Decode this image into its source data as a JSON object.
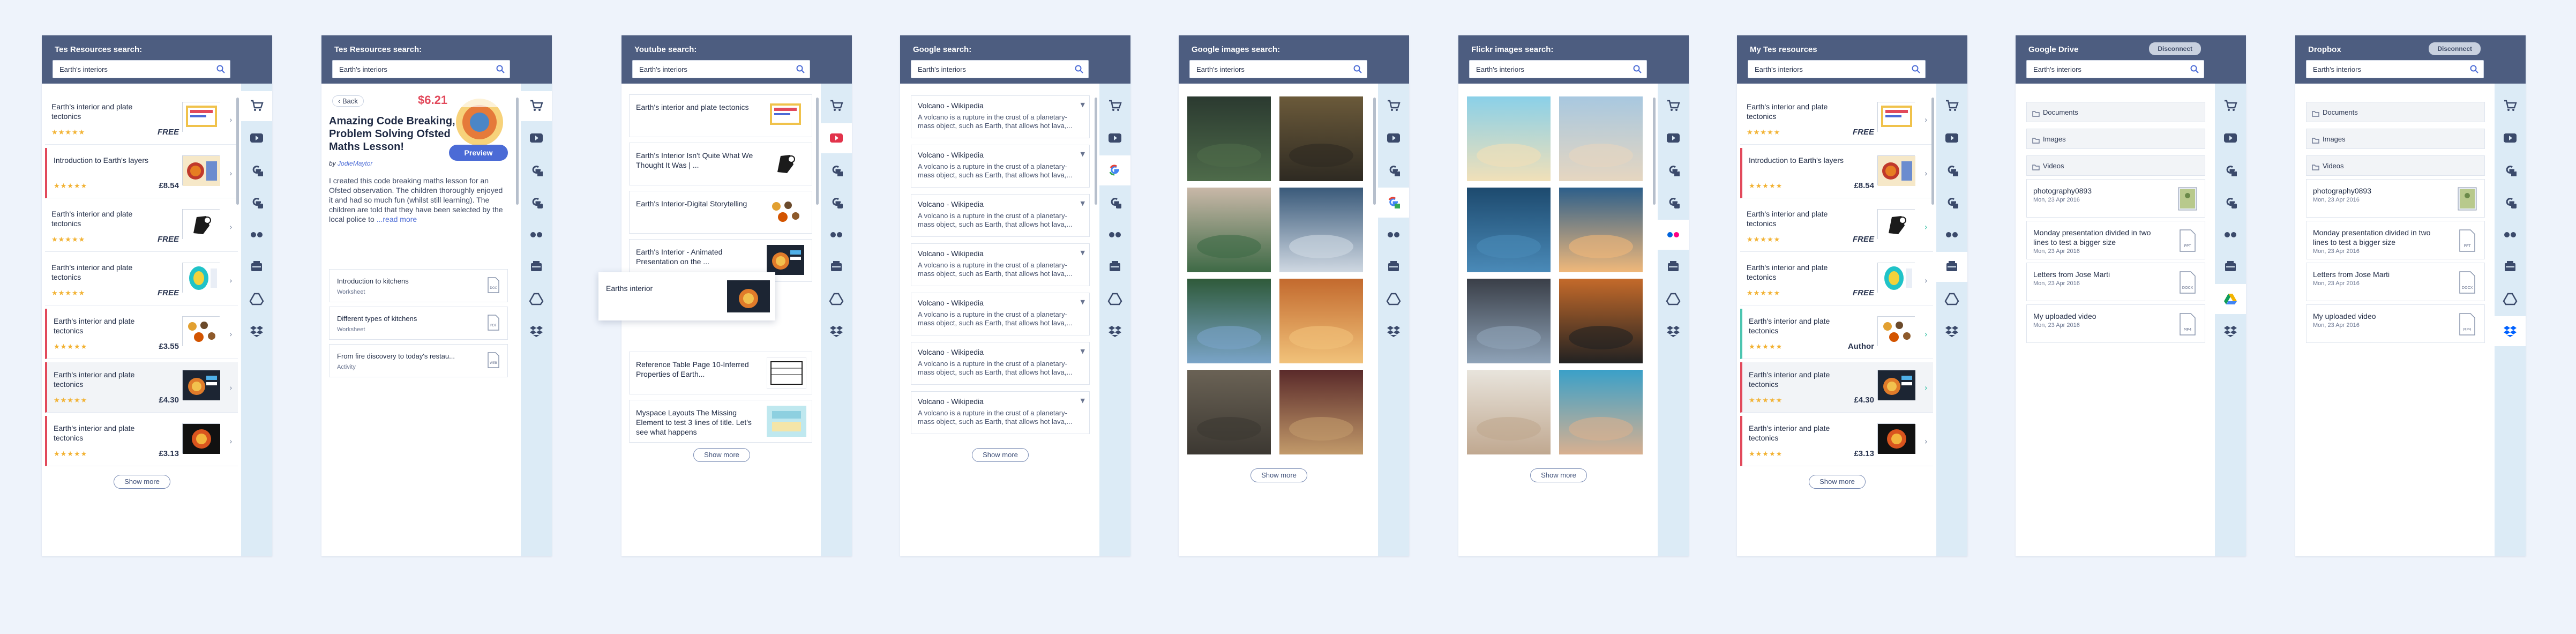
{
  "colors": {
    "header": "#4d5d80",
    "rail": "#dcebf6",
    "accent": "#4b6bd6",
    "price_red": "#e2495b",
    "star": "#f2b233",
    "teal": "#4cc5b0"
  },
  "search_query": "Earth's interiors",
  "show_more": "Show more",
  "rail_icons": [
    "cart-icon",
    "youtube-icon",
    "google-icon",
    "google-images-icon",
    "flickr-icon",
    "tes-box-icon",
    "drive-icon",
    "dropbox-icon"
  ],
  "panels": {
    "tes": {
      "title": "Tes Resources search:",
      "items": [
        {
          "title": "Earth's interior and plate tectonics",
          "price": "FREE",
          "stars": "★★★★★"
        },
        {
          "title": "Introduction to Earth's layers",
          "price": "£8.54",
          "stars": "★★★★★"
        },
        {
          "title": "Earth's interior and plate tectonics",
          "price": "FREE",
          "stars": "★★★★★"
        },
        {
          "title": "Earth's interior and plate tectonics",
          "price": "FREE",
          "stars": "★★★★★"
        },
        {
          "title": "Earth's interior and plate tectonics",
          "price": "£3.55",
          "stars": "★★★★★"
        },
        {
          "title": "Earth's interior and plate tectonics",
          "price": "£4.30",
          "stars": "★★★★★"
        },
        {
          "title": "Earth's interior and plate tectonics",
          "price": "£3.13",
          "stars": "★★★★★"
        }
      ]
    },
    "preview": {
      "title": "Tes Resources search:",
      "back": "‹ Back",
      "price": "$6.21",
      "heading": "Amazing Code Breaking, Problem Solving Ofsted Maths Lesson!",
      "by": "by",
      "author": "JodieMaytor",
      "preview_btn": "Preview",
      "description": "I created this code breaking maths lesson for an Ofsted observation. The children thoroughly enjoyed it and had so much fun (whilst still learning). The children are told that they have been selected by the local police to ",
      "read_more": "...read more",
      "resources": [
        {
          "name": "Introduction to kitchens",
          "type": "Worksheet",
          "icon": "DOC"
        },
        {
          "name": "Different types of kitchens",
          "type": "Worksheet",
          "icon": "PDF"
        },
        {
          "name": "From fire discovery to today's restau...",
          "type": "Activity",
          "icon": "WEB"
        }
      ]
    },
    "youtube": {
      "title": "Youtube search:",
      "items": [
        "Earth's interior and plate tectonics",
        "Earth's Interior Isn't Quite What We Thought It Was | ...",
        "Earth's Interior-Digital Storytelling",
        "Earth's Interior - Animated Presentation on the ...",
        "Reference Table Page 10-Inferred Properties of Earth...",
        "Myspace Layouts The Missing Element to test 3 lines of title. Let's see what happens"
      ],
      "tooltip": "Earths interior"
    },
    "google": {
      "title": "Google search:",
      "result_title": "Volcano - Wikipedia",
      "result_text": "A volcano is a rupture in the crust of a planetary-mass object, such as Earth, that allows hot lava,...",
      "count": 7
    },
    "google_images": {
      "title": "Google images search:"
    },
    "flickr": {
      "title": "Flickr images search:"
    },
    "my_tes": {
      "title": "My Tes resources",
      "items": [
        {
          "title": "Earth's interior and plate tectonics",
          "price": "FREE",
          "stars": "★★★★★"
        },
        {
          "title": "Introduction to Earth's layers",
          "price": "£8.54",
          "stars": "★★★★★"
        },
        {
          "title": "Earth's interior and plate tectonics",
          "price": "FREE",
          "stars": "★★★★★"
        },
        {
          "title": "Earth's interior and plate tectonics",
          "price": "FREE",
          "stars": "★★★★★"
        },
        {
          "title": "Earth's interior and plate tectonics",
          "price": "Author",
          "stars": "★★★★★"
        },
        {
          "title": "Earth's interior and plate tectonics",
          "price": "£4.30",
          "stars": "★★★★★"
        },
        {
          "title": "Earth's interior and plate tectonics",
          "price": "£3.13",
          "stars": "★★★★★"
        }
      ]
    },
    "drive": {
      "title": "Google Drive",
      "disconnect": "Disconnect",
      "folders": [
        "Documents",
        "Images",
        "Videos"
      ],
      "files": [
        {
          "name": "photography0893",
          "date": "Mon, 23 Apr 2016",
          "icon": "IMG"
        },
        {
          "name": "Monday presentation divided in two lines to test a bigger size",
          "date": "Mon, 23 Apr 2016",
          "icon": "PPT"
        },
        {
          "name": "Letters from Jose Marti",
          "date": "Mon, 23 Apr 2016",
          "icon": "DOCX"
        },
        {
          "name": "My uploaded video",
          "date": "Mon, 23 Apr 2016",
          "icon": "MP4"
        }
      ]
    },
    "dropbox": {
      "title": "Dropbox",
      "disconnect": "Disconnect",
      "folders": [
        "Documents",
        "Images",
        "Videos"
      ],
      "files": [
        {
          "name": "photography0893",
          "date": "Mon, 23 Apr 2016",
          "icon": "IMG"
        },
        {
          "name": "Monday presentation divided in two lines to test a bigger size",
          "date": "Mon, 23 Apr 2016",
          "icon": "PPT"
        },
        {
          "name": "Letters from Jose Marti",
          "date": "Mon, 23 Apr 2016",
          "icon": "DOCX"
        },
        {
          "name": "My uploaded video",
          "date": "Mon, 23 Apr 2016",
          "icon": "MP4"
        }
      ]
    }
  }
}
